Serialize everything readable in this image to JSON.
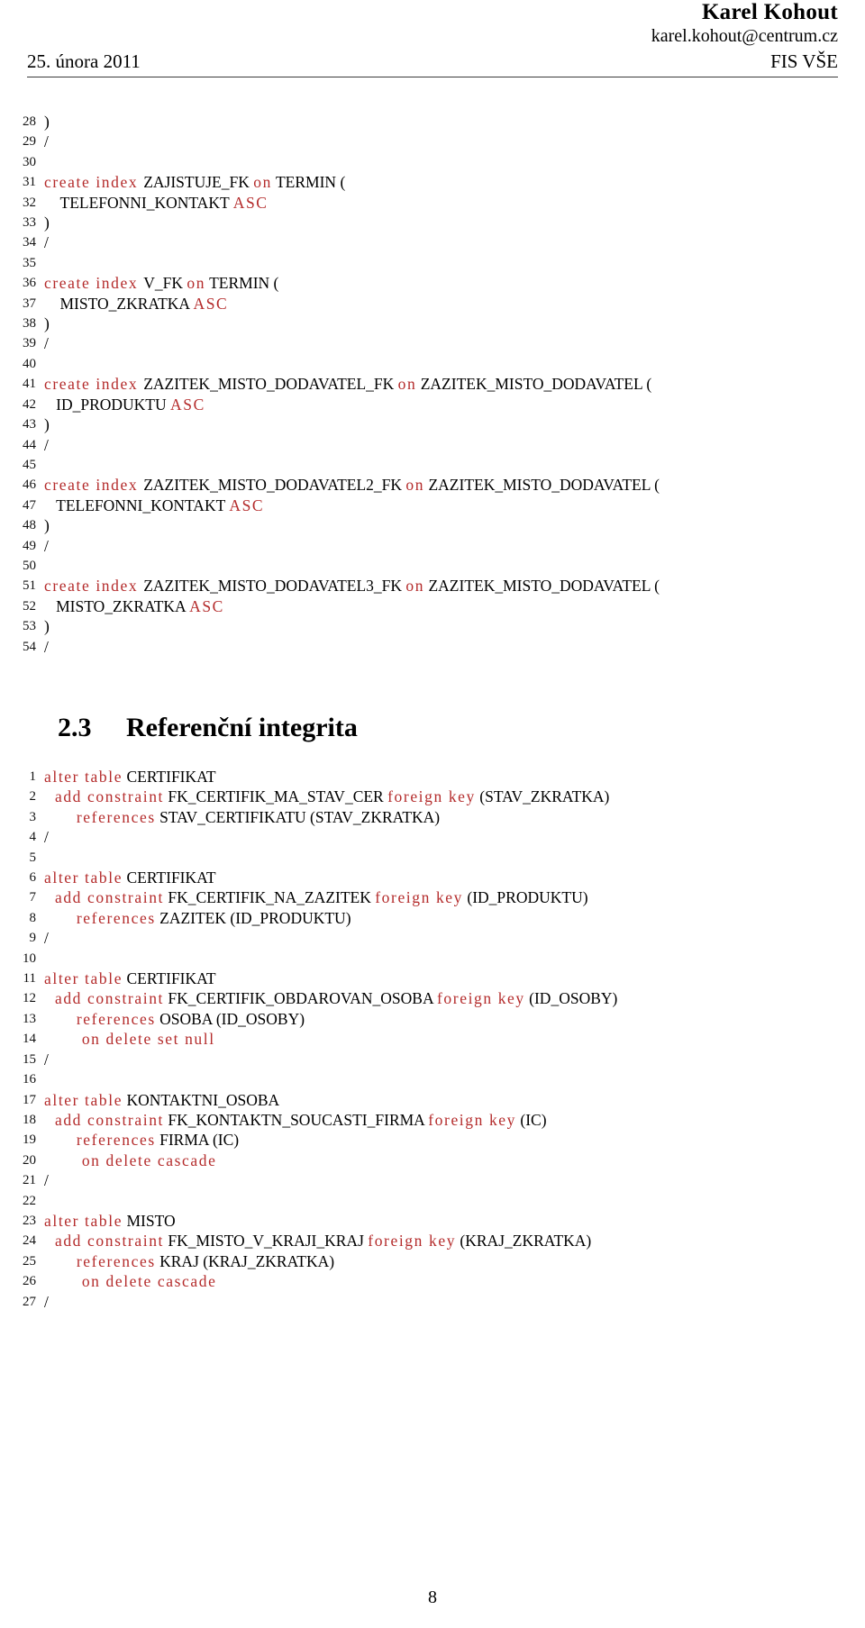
{
  "header": {
    "author": "Karel Kohout",
    "email": "karel.kohout@centrum.cz",
    "date": "25. února 2011",
    "institution": "FIS VŠE"
  },
  "footer": {
    "page_number": "8"
  },
  "section": {
    "number": "2.3",
    "title": "Referenční integrita"
  },
  "colors": {
    "keyword": "#b42b2b",
    "identifier": "#000000",
    "rule": "#3a3a3a"
  },
  "listing_indexes": {
    "lines": [
      {
        "n": "28",
        "tokens": [
          {
            "t": ")",
            "c": "punc"
          }
        ]
      },
      {
        "n": "29",
        "tokens": [
          {
            "t": "/",
            "c": "punc"
          }
        ]
      },
      {
        "n": "30",
        "tokens": []
      },
      {
        "n": "31",
        "tokens": [
          {
            "t": "create index ",
            "c": "kw"
          },
          {
            "t": "ZAJISTUJE_FK ",
            "c": "id"
          },
          {
            "t": "on",
            "c": "kw"
          },
          {
            "t": " TERMIN (",
            "c": "id"
          }
        ]
      },
      {
        "n": "32",
        "tokens": [
          {
            "t": "    TELEFONNI_KONTAKT ",
            "c": "id"
          },
          {
            "t": "ASC",
            "c": "kw"
          }
        ]
      },
      {
        "n": "33",
        "tokens": [
          {
            "t": ")",
            "c": "punc"
          }
        ]
      },
      {
        "n": "34",
        "tokens": [
          {
            "t": "/",
            "c": "punc"
          }
        ]
      },
      {
        "n": "35",
        "tokens": []
      },
      {
        "n": "36",
        "tokens": [
          {
            "t": "create index ",
            "c": "kw"
          },
          {
            "t": "V_FK ",
            "c": "id"
          },
          {
            "t": "on",
            "c": "kw"
          },
          {
            "t": " TERMIN (",
            "c": "id"
          }
        ]
      },
      {
        "n": "37",
        "tokens": [
          {
            "t": "    MISTO_ZKRATKA ",
            "c": "id"
          },
          {
            "t": "ASC",
            "c": "kw"
          }
        ]
      },
      {
        "n": "38",
        "tokens": [
          {
            "t": ")",
            "c": "punc"
          }
        ]
      },
      {
        "n": "39",
        "tokens": [
          {
            "t": "/",
            "c": "punc"
          }
        ]
      },
      {
        "n": "40",
        "tokens": []
      },
      {
        "n": "41",
        "tokens": [
          {
            "t": "create index ",
            "c": "kw"
          },
          {
            "t": "ZAZITEK_MISTO_DODAVATEL_FK ",
            "c": "id"
          },
          {
            "t": "on",
            "c": "kw"
          },
          {
            "t": " ZAZITEK_MISTO_DODAVATEL (",
            "c": "id"
          }
        ]
      },
      {
        "n": "42",
        "tokens": [
          {
            "t": "   ID_PRODUKTU ",
            "c": "id"
          },
          {
            "t": "ASC",
            "c": "kw"
          }
        ]
      },
      {
        "n": "43",
        "tokens": [
          {
            "t": ")",
            "c": "punc"
          }
        ]
      },
      {
        "n": "44",
        "tokens": [
          {
            "t": "/",
            "c": "punc"
          }
        ]
      },
      {
        "n": "45",
        "tokens": []
      },
      {
        "n": "46",
        "tokens": [
          {
            "t": "create index ",
            "c": "kw"
          },
          {
            "t": "ZAZITEK_MISTO_DODAVATEL2_FK ",
            "c": "id"
          },
          {
            "t": "on",
            "c": "kw"
          },
          {
            "t": " ZAZITEK_MISTO_DODAVATEL (",
            "c": "id"
          }
        ]
      },
      {
        "n": "47",
        "tokens": [
          {
            "t": "   TELEFONNI_KONTAKT ",
            "c": "id"
          },
          {
            "t": "ASC",
            "c": "kw"
          }
        ]
      },
      {
        "n": "48",
        "tokens": [
          {
            "t": ")",
            "c": "punc"
          }
        ]
      },
      {
        "n": "49",
        "tokens": [
          {
            "t": "/",
            "c": "punc"
          }
        ]
      },
      {
        "n": "50",
        "tokens": []
      },
      {
        "n": "51",
        "tokens": [
          {
            "t": "create index ",
            "c": "kw"
          },
          {
            "t": "ZAZITEK_MISTO_DODAVATEL3_FK ",
            "c": "id"
          },
          {
            "t": "on",
            "c": "kw"
          },
          {
            "t": " ZAZITEK_MISTO_DODAVATEL (",
            "c": "id"
          }
        ]
      },
      {
        "n": "52",
        "tokens": [
          {
            "t": "   MISTO_ZKRATKA ",
            "c": "id"
          },
          {
            "t": "ASC",
            "c": "kw"
          }
        ]
      },
      {
        "n": "53",
        "tokens": [
          {
            "t": ")",
            "c": "punc"
          }
        ]
      },
      {
        "n": "54",
        "tokens": [
          {
            "t": "/",
            "c": "punc"
          }
        ]
      }
    ]
  },
  "listing_constraints": {
    "lines": [
      {
        "n": "1",
        "tokens": [
          {
            "t": "alter table",
            "c": "kw"
          },
          {
            "t": " CERTIFIKAT",
            "c": "id"
          }
        ]
      },
      {
        "n": "2",
        "tokens": [
          {
            "t": "  add constraint",
            "c": "kw"
          },
          {
            "t": " FK_CERTIFIK_MA_STAV_CER ",
            "c": "id"
          },
          {
            "t": "foreign key",
            "c": "kw"
          },
          {
            "t": " (STAV_ZKRATKA)",
            "c": "id"
          }
        ]
      },
      {
        "n": "3",
        "tokens": [
          {
            "t": "      references",
            "c": "kw"
          },
          {
            "t": " STAV_CERTIFIKATU (STAV_ZKRATKA)",
            "c": "id"
          }
        ]
      },
      {
        "n": "4",
        "tokens": [
          {
            "t": "/",
            "c": "punc"
          }
        ]
      },
      {
        "n": "5",
        "tokens": []
      },
      {
        "n": "6",
        "tokens": [
          {
            "t": "alter table",
            "c": "kw"
          },
          {
            "t": " CERTIFIKAT",
            "c": "id"
          }
        ]
      },
      {
        "n": "7",
        "tokens": [
          {
            "t": "  add constraint",
            "c": "kw"
          },
          {
            "t": " FK_CERTIFIK_NA_ZAZITEK ",
            "c": "id"
          },
          {
            "t": "foreign key",
            "c": "kw"
          },
          {
            "t": " (ID_PRODUKTU)",
            "c": "id"
          }
        ]
      },
      {
        "n": "8",
        "tokens": [
          {
            "t": "      references",
            "c": "kw"
          },
          {
            "t": " ZAZITEK (ID_PRODUKTU)",
            "c": "id"
          }
        ]
      },
      {
        "n": "9",
        "tokens": [
          {
            "t": "/",
            "c": "punc"
          }
        ]
      },
      {
        "n": "10",
        "tokens": []
      },
      {
        "n": "11",
        "tokens": [
          {
            "t": "alter table",
            "c": "kw"
          },
          {
            "t": " CERTIFIKAT",
            "c": "id"
          }
        ]
      },
      {
        "n": "12",
        "tokens": [
          {
            "t": "  add constraint",
            "c": "kw"
          },
          {
            "t": " FK_CERTIFIK_OBDAROVAN_OSOBA ",
            "c": "id"
          },
          {
            "t": "foreign key",
            "c": "kw"
          },
          {
            "t": " (ID_OSOBY)",
            "c": "id"
          }
        ]
      },
      {
        "n": "13",
        "tokens": [
          {
            "t": "      references",
            "c": "kw"
          },
          {
            "t": " OSOBA (ID_OSOBY)",
            "c": "id"
          }
        ]
      },
      {
        "n": "14",
        "tokens": [
          {
            "t": "       on delete set null",
            "c": "kw"
          }
        ]
      },
      {
        "n": "15",
        "tokens": [
          {
            "t": "/",
            "c": "punc"
          }
        ]
      },
      {
        "n": "16",
        "tokens": []
      },
      {
        "n": "17",
        "tokens": [
          {
            "t": "alter table",
            "c": "kw"
          },
          {
            "t": " KONTAKTNI_OSOBA",
            "c": "id"
          }
        ]
      },
      {
        "n": "18",
        "tokens": [
          {
            "t": "  add constraint",
            "c": "kw"
          },
          {
            "t": " FK_KONTAKTN_SOUCASTI_FIRMA ",
            "c": "id"
          },
          {
            "t": "foreign key",
            "c": "kw"
          },
          {
            "t": " (IC)",
            "c": "id"
          }
        ]
      },
      {
        "n": "19",
        "tokens": [
          {
            "t": "      references",
            "c": "kw"
          },
          {
            "t": " FIRMA (IC)",
            "c": "id"
          }
        ]
      },
      {
        "n": "20",
        "tokens": [
          {
            "t": "       on delete cascade",
            "c": "kw"
          }
        ]
      },
      {
        "n": "21",
        "tokens": [
          {
            "t": "/",
            "c": "punc"
          }
        ]
      },
      {
        "n": "22",
        "tokens": []
      },
      {
        "n": "23",
        "tokens": [
          {
            "t": "alter table",
            "c": "kw"
          },
          {
            "t": " MISTO",
            "c": "id"
          }
        ]
      },
      {
        "n": "24",
        "tokens": [
          {
            "t": "  add constraint",
            "c": "kw"
          },
          {
            "t": " FK_MISTO_V_KRAJI_KRAJ ",
            "c": "id"
          },
          {
            "t": "foreign key",
            "c": "kw"
          },
          {
            "t": " (KRAJ_ZKRATKA)",
            "c": "id"
          }
        ]
      },
      {
        "n": "25",
        "tokens": [
          {
            "t": "      references",
            "c": "kw"
          },
          {
            "t": " KRAJ (KRAJ_ZKRATKA)",
            "c": "id"
          }
        ]
      },
      {
        "n": "26",
        "tokens": [
          {
            "t": "       on delete cascade",
            "c": "kw"
          }
        ]
      },
      {
        "n": "27",
        "tokens": [
          {
            "t": "/",
            "c": "punc"
          }
        ]
      }
    ]
  }
}
